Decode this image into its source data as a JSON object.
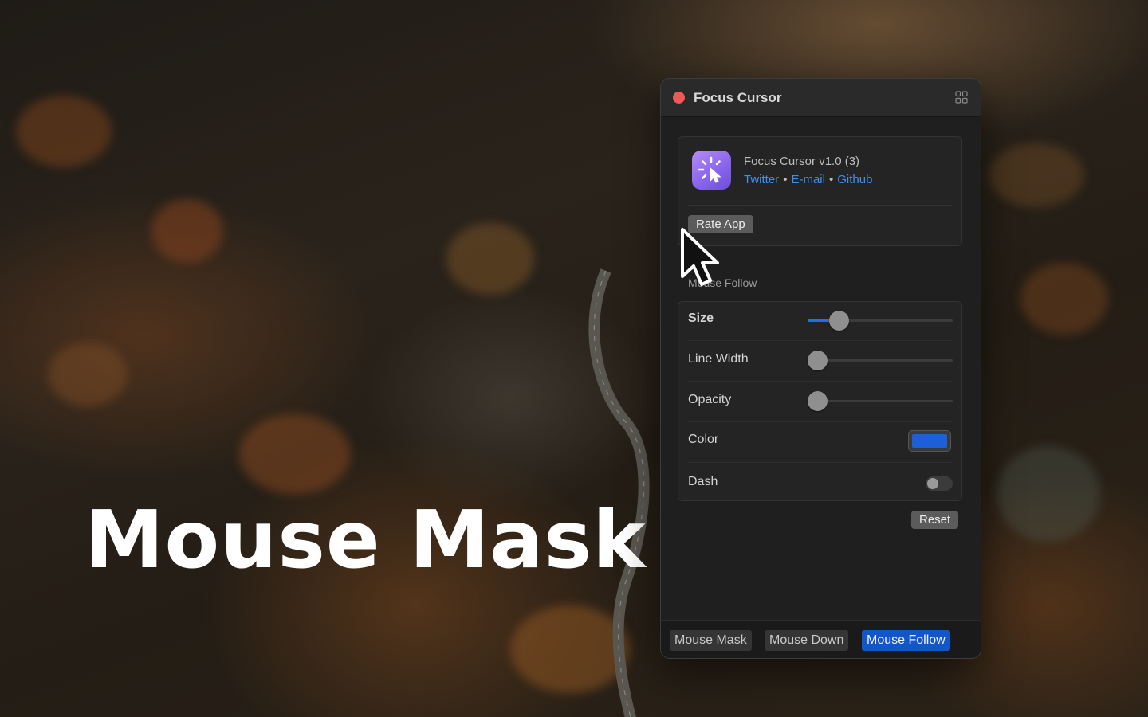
{
  "hero": {
    "title": "Mouse Mask"
  },
  "window": {
    "title": "Focus Cursor",
    "icons": {
      "close": "close-dot",
      "layout": "grid-icon"
    }
  },
  "about": {
    "app_name": "Focus Cursor v1.0 (3)",
    "links": [
      "Twitter",
      "E-mail",
      "Github"
    ],
    "separator": "•",
    "rate_button": "Rate App"
  },
  "section": {
    "label": "Mouse Follow"
  },
  "settings": {
    "size": {
      "label": "Size",
      "value": 0.17
    },
    "line_width": {
      "label": "Line Width",
      "value": 0.0
    },
    "opacity": {
      "label": "Opacity",
      "value": 0.0
    },
    "color": {
      "label": "Color",
      "value": "#1c5fd6"
    },
    "dash": {
      "label": "Dash",
      "on": false
    }
  },
  "reset_button": "Reset",
  "tabs": [
    {
      "label": "Mouse Mask",
      "active": false
    },
    {
      "label": "Mouse Down",
      "active": false
    },
    {
      "label": "Mouse Follow",
      "active": true
    }
  ],
  "colors": {
    "accent": "#1356c8",
    "link": "#3f8ef0",
    "close": "#ed5a55"
  }
}
